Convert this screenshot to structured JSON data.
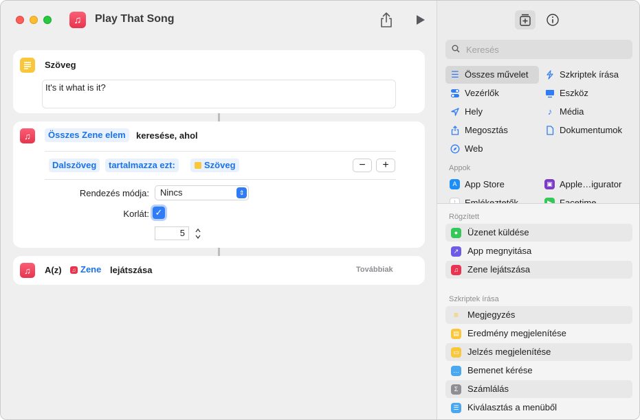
{
  "window": {
    "title": "Play That Song"
  },
  "colors": {
    "accent": "#2f7cf6",
    "music": "#e8344e",
    "text_action": "#f8c73c"
  },
  "editor": {
    "text_action": {
      "title": "Szöveg",
      "value": "It's it what is it?"
    },
    "find_action": {
      "token_all": "Összes Zene elem",
      "title_suffix": "keresése, ahol",
      "filter": {
        "field": "Dalszöveg",
        "operator": "tartalmazza ezt:",
        "variable": "Szöveg"
      },
      "minus_label": "−",
      "plus_label": "+",
      "sort_label": "Rendezés módja:",
      "sort_value": "Nincs",
      "limit_label": "Korlát:",
      "limit_checked": true,
      "limit_value": "5"
    },
    "play_action": {
      "prefix": "A(z)",
      "variable": "Zene",
      "suffix": "lejátszása",
      "more": "Továbbiak"
    }
  },
  "library": {
    "search_placeholder": "Keresés",
    "categories_left": [
      {
        "label": "Összes művelet",
        "icon": "list-icon",
        "selected": true
      },
      {
        "label": "Vezérlők",
        "icon": "toggle-icon"
      },
      {
        "label": "Hely",
        "icon": "location-icon"
      },
      {
        "label": "Megosztás",
        "icon": "share-icon"
      },
      {
        "label": "Web",
        "icon": "compass-icon"
      }
    ],
    "categories_right": [
      {
        "label": "Szkriptek írása",
        "icon": "script-icon"
      },
      {
        "label": "Eszköz",
        "icon": "display-icon"
      },
      {
        "label": "Média",
        "icon": "music-note-icon"
      },
      {
        "label": "Dokumentumok",
        "icon": "document-icon"
      }
    ],
    "apps_heading": "Appok",
    "apps": [
      {
        "label": "App Store",
        "icon": "app-store-icon",
        "color": "#1c8ef9"
      },
      {
        "label": "Apple…igurator",
        "icon": "configurator-icon",
        "color": "#7a3cc6"
      },
      {
        "label": "Emlékeztetők",
        "icon": "reminders-icon",
        "color": "#ffffff"
      },
      {
        "label": "Facetime",
        "icon": "facetime-icon",
        "color": "#34c759"
      }
    ],
    "pinned_heading": "Rögzített",
    "pinned": [
      {
        "label": "Üzenet küldése",
        "icon": "messages-icon",
        "color": "#34c759"
      },
      {
        "label": "App megnyitása",
        "icon": "open-app-icon",
        "color": "#6e5ce6"
      },
      {
        "label": "Zene lejátszása",
        "icon": "music-icon",
        "color": "#e8344e"
      }
    ],
    "scripting_heading": "Szkriptek írása",
    "scripting": [
      {
        "label": "Megjegyzés",
        "icon": "comment-icon",
        "color": "#f8c73c"
      },
      {
        "label": "Eredmény megjelenítése",
        "icon": "result-icon",
        "color": "#f8c73c"
      },
      {
        "label": "Jelzés megjelenítése",
        "icon": "alert-icon",
        "color": "#f8c73c"
      },
      {
        "label": "Bemenet kérése",
        "icon": "ask-input-icon",
        "color": "#4aa8f0"
      },
      {
        "label": "Számlálás",
        "icon": "count-icon",
        "color": "#8e8e93"
      },
      {
        "label": "Kiválasztás a menüből",
        "icon": "menu-icon",
        "color": "#4aa8f0"
      }
    ]
  }
}
